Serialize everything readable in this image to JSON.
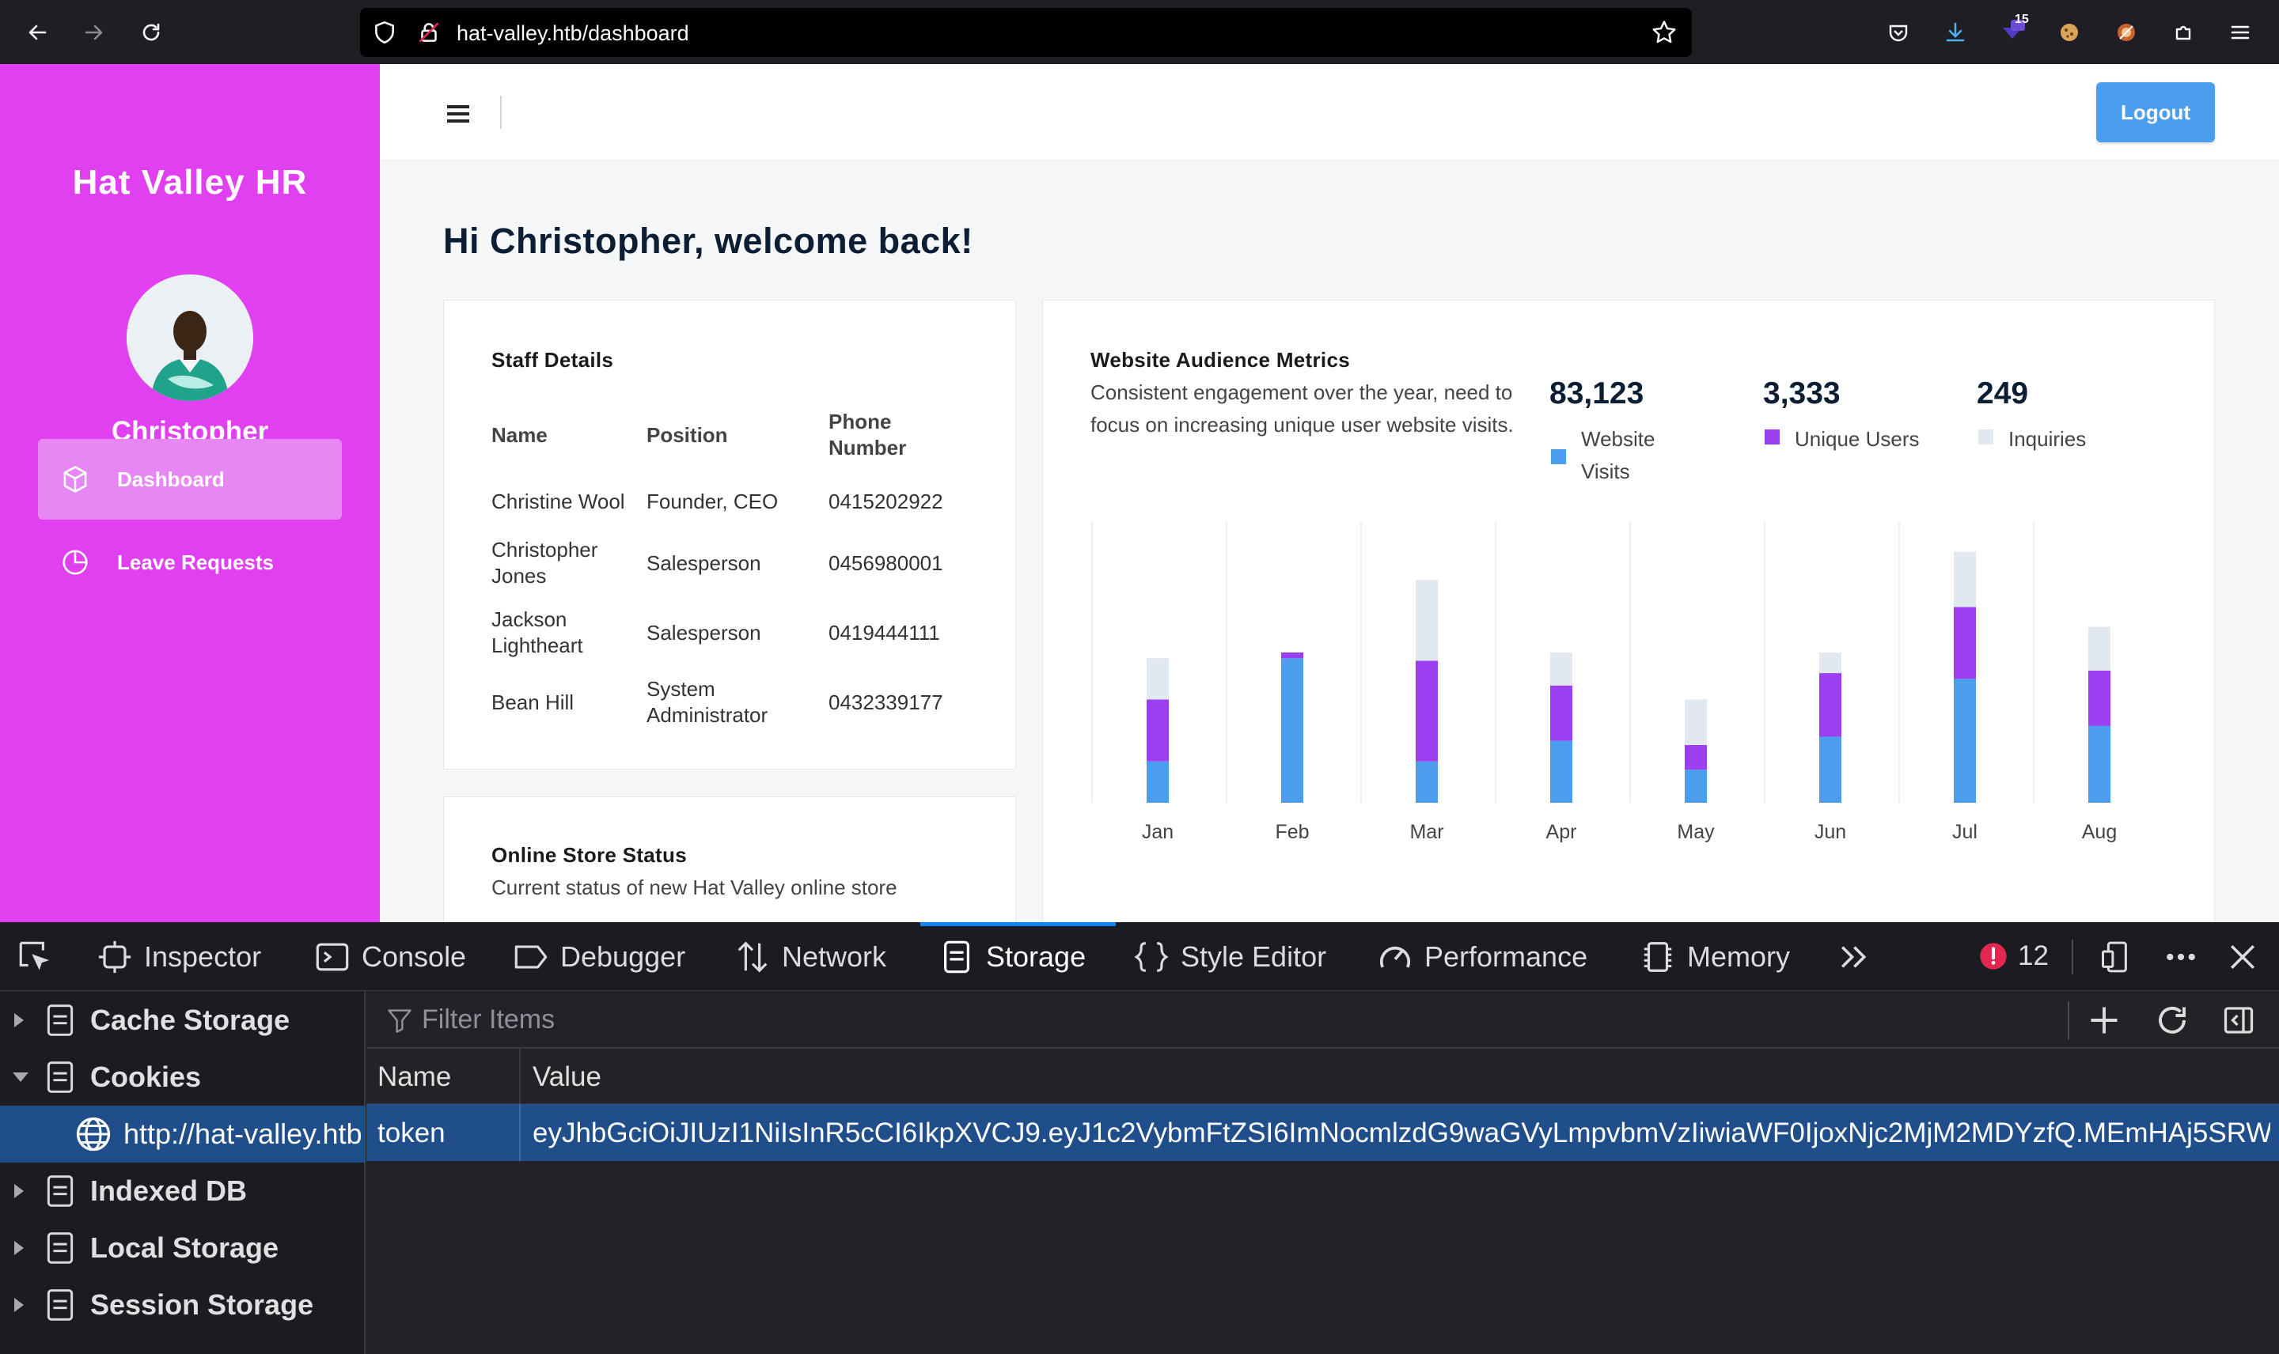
{
  "browser": {
    "url": "hat-valley.htb/dashboard",
    "badge_count": "15"
  },
  "sidebar": {
    "brand": "Hat Valley HR",
    "user_name": "Christopher",
    "items": [
      {
        "label": "Dashboard",
        "icon": "cube-icon",
        "active": true
      },
      {
        "label": "Leave Requests",
        "icon": "pie-chart-icon",
        "active": false
      }
    ]
  },
  "header": {
    "logout_label": "Logout"
  },
  "main": {
    "welcome": "Hi Christopher, welcome back!",
    "staff": {
      "title": "Staff Details",
      "columns": [
        "Name",
        "Position",
        "Phone Number"
      ],
      "rows": [
        {
          "name": "Christine Wool",
          "position": "Founder, CEO",
          "phone": "0415202922"
        },
        {
          "name": "Christopher Jones",
          "position": "Salesperson",
          "phone": "0456980001"
        },
        {
          "name": "Jackson Lightheart",
          "position": "Salesperson",
          "phone": "0419444111"
        },
        {
          "name": "Bean Hill",
          "position": "System Administrator",
          "phone": "0432339177"
        }
      ]
    },
    "store": {
      "title": "Online Store Status",
      "subtitle": "Current status of new Hat Valley online store"
    },
    "metrics": {
      "title": "Website Audience Metrics",
      "description": "Consistent engagement over the year, need to focus on increasing unique user website visits.",
      "stats": [
        {
          "value": "83,123",
          "label": "Website Visits",
          "color": "#4b9dee"
        },
        {
          "value": "3,333",
          "label": "Unique Users",
          "color": "#9b3ff0"
        },
        {
          "value": "249",
          "label": "Inquiries",
          "color": "#e2e8f0"
        }
      ]
    }
  },
  "chart_data": {
    "type": "bar",
    "stacked": true,
    "categories": [
      "Jan",
      "Feb",
      "Mar",
      "Apr",
      "May",
      "Jun",
      "Jul",
      "Aug"
    ],
    "series": [
      {
        "name": "Website Visits",
        "color": "#4b9dee",
        "values": [
          50,
          175,
          50,
          75,
          40,
          80,
          150,
          93
        ]
      },
      {
        "name": "Unique Users",
        "color": "#9b3ff0",
        "values": [
          75,
          7,
          122,
          67,
          30,
          77,
          87,
          67
        ]
      },
      {
        "name": "Inquiries",
        "color": "#e2e8f0",
        "values": [
          50,
          0,
          98,
          40,
          55,
          25,
          67,
          53
        ]
      }
    ],
    "ylim": [
      0,
      340
    ],
    "grid": true
  },
  "devtools": {
    "tabs": [
      {
        "label": "Inspector",
        "icon": "inspector-icon"
      },
      {
        "label": "Console",
        "icon": "console-icon"
      },
      {
        "label": "Debugger",
        "icon": "debugger-icon"
      },
      {
        "label": "Network",
        "icon": "network-icon"
      },
      {
        "label": "Storage",
        "icon": "storage-icon",
        "active": true
      },
      {
        "label": "Style Editor",
        "icon": "style-editor-icon"
      },
      {
        "label": "Performance",
        "icon": "performance-icon"
      },
      {
        "label": "Memory",
        "icon": "memory-icon"
      }
    ],
    "error_count": "12",
    "tree": [
      {
        "label": "Cache Storage",
        "expanded": false
      },
      {
        "label": "Cookies",
        "expanded": true
      },
      {
        "label": "http://hat-valley.htb",
        "child": true,
        "selected": true
      },
      {
        "label": "Indexed DB",
        "expanded": false
      },
      {
        "label": "Local Storage",
        "expanded": false
      },
      {
        "label": "Session Storage",
        "expanded": false
      }
    ],
    "filter_placeholder": "Filter Items",
    "columns": [
      "Name",
      "Value"
    ],
    "cookie": {
      "name": "token",
      "value": "eyJhbGciOiJIUzI1NiIsInR5cCI6IkpXVCJ9.eyJ1c2VybmFtZSI6ImNocmlzdG9waGVyLmpvbmVzIiwiaWF0IjoxNjc2MjM2MDYzfQ.MEmHAj5SRW..."
    }
  }
}
